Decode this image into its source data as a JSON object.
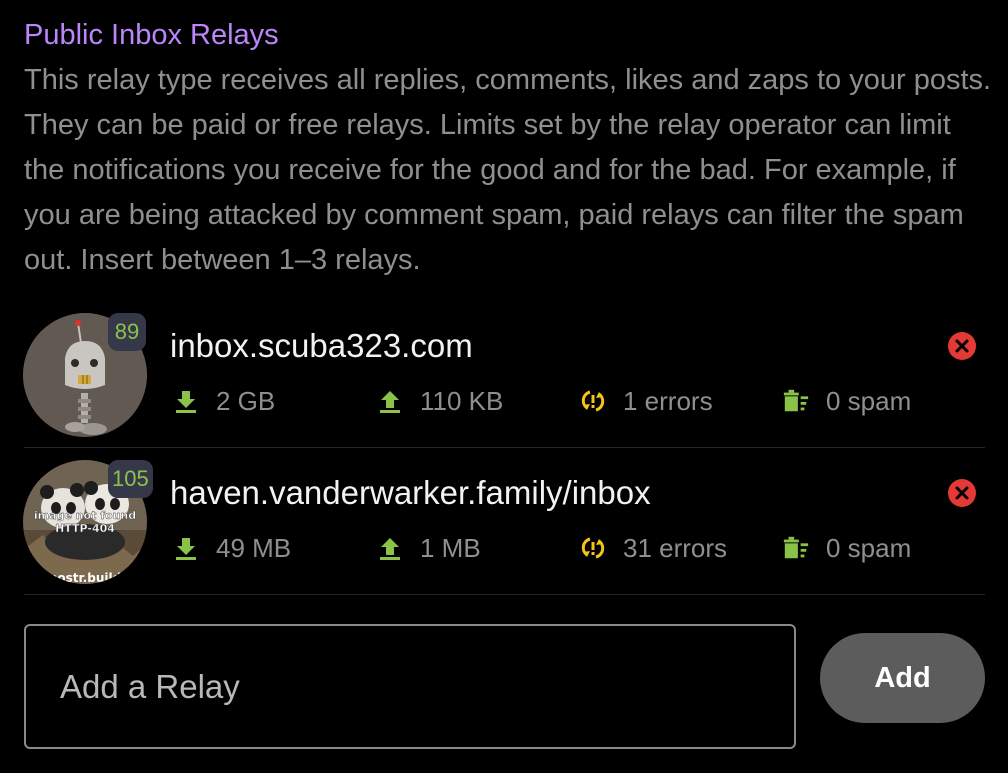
{
  "section": {
    "title": "Public Inbox Relays",
    "description": "This relay type receives all replies, comments, likes and zaps to your posts. They can be paid or free relays. Limits set by the relay operator can limit the notifications you receive for the good and for the bad. For example, if you are being attacked by comment spam, paid relays can filter the spam out. Insert between 1–3 relays."
  },
  "colors": {
    "title": "#bb86fc",
    "badge_text": "#8bc34a",
    "download_icon": "#8bc34a",
    "upload_icon": "#8bc34a",
    "errors_icon": "#f5c518",
    "spam_icon": "#8bc34a",
    "remove_icon": "#e53935"
  },
  "relays": [
    {
      "count": "89",
      "url": "inbox.scuba323.com",
      "download": "2 GB",
      "upload": "110 KB",
      "errors": "1 errors",
      "spam": "0 spam",
      "avatar_icon": "robot-avatar-icon",
      "avatar_overlay": []
    },
    {
      "count": "105",
      "url": "haven.vanderwarker.family/inbox",
      "download": "49 MB",
      "upload": "1 MB",
      "errors": "31 errors",
      "spam": "0 spam",
      "avatar_icon": "panda-avatar-icon",
      "avatar_overlay": [
        "image not found",
        "HTTP-404",
        "nostr.build"
      ]
    }
  ],
  "icons": {
    "download": "download-icon",
    "upload": "upload-icon",
    "errors": "sync-problem-icon",
    "spam": "delete-sweep-icon",
    "remove": "remove-circle-icon"
  },
  "add_relay": {
    "placeholder": "Add a Relay",
    "value": "",
    "button_label": "Add"
  }
}
